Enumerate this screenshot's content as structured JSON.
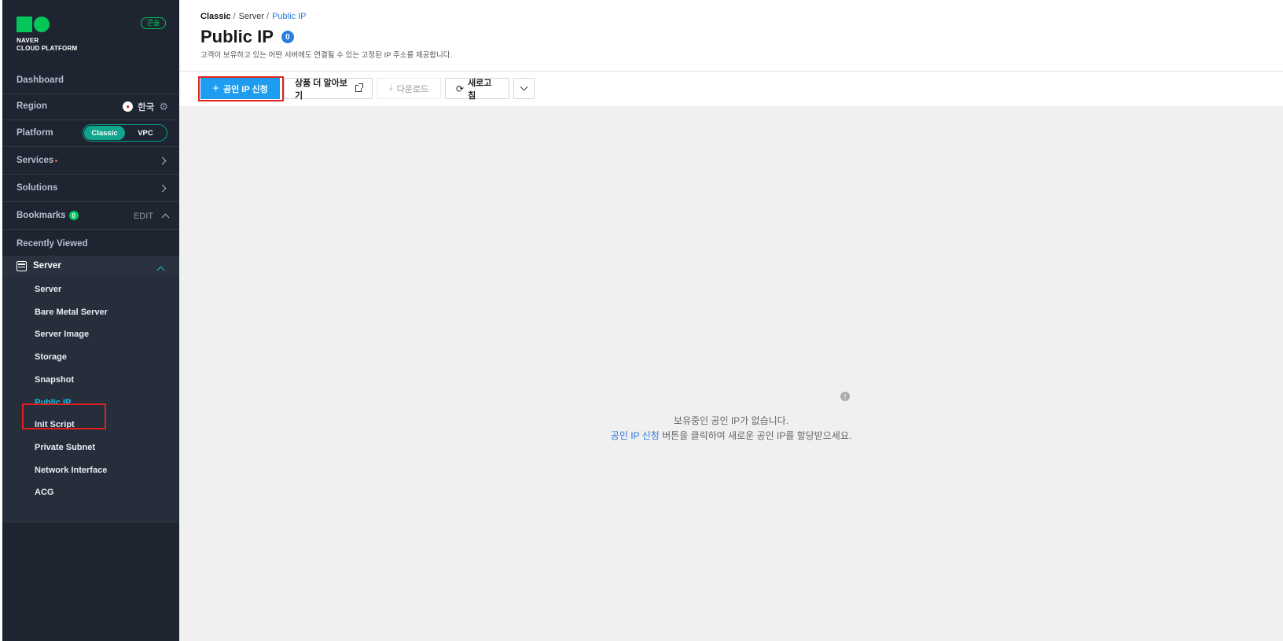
{
  "sidebar": {
    "logo_line1": "NAVER",
    "logo_line2": "CLOUD PLATFORM",
    "console_badge": "콘솔",
    "dashboard": "Dashboard",
    "region": {
      "label": "Region",
      "value": "한국"
    },
    "platform": {
      "label": "Platform",
      "options": [
        "Classic",
        "VPC"
      ],
      "selected": "Classic"
    },
    "services": "Services",
    "solutions": "Solutions",
    "bookmarks": {
      "label": "Bookmarks",
      "count": "0",
      "edit": "EDIT"
    },
    "recently_viewed": "Recently Viewed",
    "server_group": {
      "title": "Server",
      "items": [
        "Server",
        "Bare Metal Server",
        "Server Image",
        "Storage",
        "Snapshot",
        "Public IP",
        "Init Script",
        "Private Subnet",
        "Network Interface",
        "ACG"
      ],
      "active": "Public IP"
    }
  },
  "header": {
    "breadcrumb": [
      "Classic",
      "Server",
      "Public IP"
    ],
    "title": "Public IP",
    "count": "0",
    "description": "고객이 보유하고 있는 어떤 서버에도 연결될 수 있는 고정된 IP 주소를 제공합니다."
  },
  "toolbar": {
    "create": "공인 IP 신청",
    "learn_more": "상품 더 알아보기",
    "download": "다운로드",
    "refresh": "새로고침"
  },
  "empty_state": {
    "line1": "보유중인 공인 IP가 없습니다.",
    "line2_link": "공인 IP 신청",
    "line2_rest": " 버튼을 클릭하여 새로운 공인 IP를 할당받으세요."
  },
  "colors": {
    "sidebar_bg": "#1e2430",
    "accent_green": "#03c75a",
    "primary_blue": "#1d9cf0",
    "active_link": "#18c0e6",
    "highlight_red": "#e02020"
  }
}
